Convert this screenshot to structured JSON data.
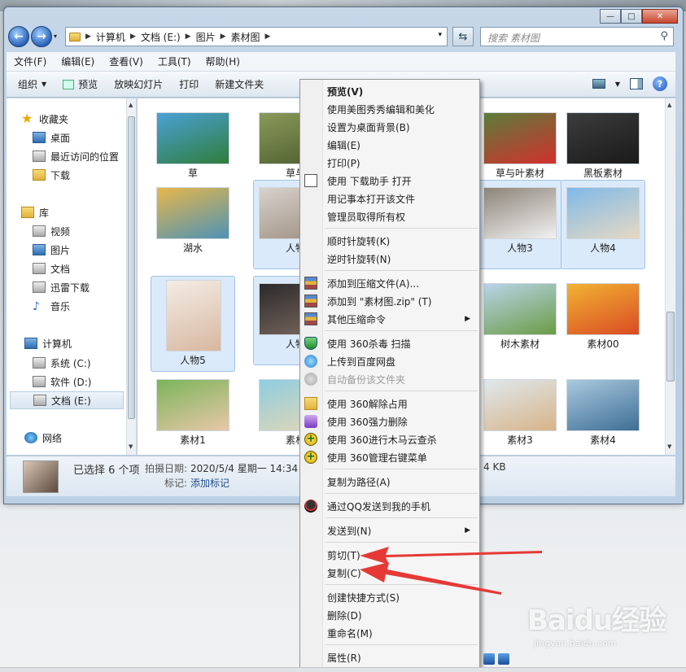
{
  "window": {
    "minimize": "—",
    "maximize": "□",
    "close": "✕"
  },
  "nav": {
    "back": "←",
    "forward": "→",
    "history_dropdown": "▾",
    "refresh": "⇆",
    "address_dropdown": "▾",
    "breadcrumbs": [
      "计算机",
      "文档 (E:)",
      "图片",
      "素材图"
    ],
    "search_placeholder": "搜索 素材图",
    "search_icon": "⚲"
  },
  "menubar": [
    "文件(F)",
    "编辑(E)",
    "查看(V)",
    "工具(T)",
    "帮助(H)"
  ],
  "toolbar": {
    "organize": "组织",
    "preview": "预览",
    "slideshow": "放映幻灯片",
    "print": "打印",
    "new_folder": "新建文件夹",
    "help": "?"
  },
  "sidebar": {
    "favorites": "收藏夹",
    "desktop": "桌面",
    "recent": "最近访问的位置",
    "downloads": "下载",
    "libraries": "库",
    "videos": "视频",
    "pictures": "图片",
    "documents": "文档",
    "xunlei": "迅雷下载",
    "music": "音乐",
    "computer": "计算机",
    "drive_c": "系统 (C:)",
    "drive_d": "软件 (D:)",
    "drive_e": "文档 (E:)",
    "network": "网络"
  },
  "files": [
    {
      "name": "草",
      "color1": "#4aa1d6",
      "color2": "#2f7d3c"
    },
    {
      "name": "草与",
      "color1": "#8a9a5a",
      "color2": "#4c5c2e"
    },
    {
      "name": "草与叶素材",
      "color1": "#5b7d3a",
      "color2": "#d2302c"
    },
    {
      "name": "黑板素材",
      "color1": "#3c3c3c",
      "color2": "#1a1a1a"
    },
    {
      "name": "湖水",
      "color1": "#e7b74a",
      "color2": "#4e92b6"
    },
    {
      "name": "人物",
      "color1": "#d7d2cc",
      "color2": "#9d8e80"
    },
    {
      "name": "人物3",
      "color1": "#8c8478",
      "color2": "#f2f2f2"
    },
    {
      "name": "人物4",
      "color1": "#7fb9e8",
      "color2": "#e6d9c4"
    },
    {
      "name": "人物5",
      "color1": "#f3ece5",
      "color2": "#d8b8a0"
    },
    {
      "name": "人物",
      "color1": "#2a2a2a",
      "color2": "#7d6a60"
    },
    {
      "name": "树木素材",
      "color1": "#b8d4e8",
      "color2": "#6b9c46"
    },
    {
      "name": "素材00",
      "color1": "#f2b233",
      "color2": "#d94c23"
    },
    {
      "name": "素材1",
      "color1": "#7bb45a",
      "color2": "#e8c7a8"
    },
    {
      "name": "素材",
      "color1": "#8ecde0",
      "color2": "#e6d7b4"
    },
    {
      "name": "素材3",
      "color1": "#dfe8ee",
      "color2": "#d7b488"
    },
    {
      "name": "素材4",
      "color1": "#aac9de",
      "color2": "#3e6e96"
    }
  ],
  "status": {
    "selected": "已选择 6 个项",
    "date_label": "拍摄日期:",
    "date_value": "2020/5/4 星期一 14:34",
    "tag_label": "标记:",
    "tag_value": "添加标记",
    "size_fragment": "4 KB"
  },
  "context_menu": {
    "preview": "预览(V)",
    "meitu": "使用美图秀秀编辑和美化",
    "set_wallpaper": "设置为桌面背景(B)",
    "edit": "编辑(E)",
    "print": "打印(P)",
    "open_download": "使用 下载助手 打开",
    "open_notepad": "用记事本打开该文件",
    "take_ownership": "管理员取得所有权",
    "rotate_cw": "顺时针旋转(K)",
    "rotate_ccw": "逆时针旋转(N)",
    "add_archive": "添加到压缩文件(A)...",
    "add_zip": "添加到 \"素材图.zip\" (T)",
    "other_zip": "其他压缩命令",
    "scan_360": "使用 360杀毒 扫描",
    "upload_baidu": "上传到百度网盘",
    "auto_backup": "自动备份该文件夹",
    "unlock_360": "使用 360解除占用",
    "force_delete_360": "使用 360强力删除",
    "trojan_360": "使用 360进行木马云查杀",
    "manage_menu_360": "使用 360管理右键菜单",
    "copy_path": "复制为路径(A)",
    "send_qq": "通过QQ发送到我的手机",
    "send_to": "发送到(N)",
    "cut": "剪切(T)",
    "copy": "复制(C)",
    "create_shortcut": "创建快捷方式(S)",
    "delete": "删除(D)",
    "rename": "重命名(M)",
    "properties": "属性(R)",
    "submenu_arrow": "▶"
  },
  "watermark": {
    "logo": "Baidu经验",
    "url": "jingyan.baidu.com"
  },
  "colors": {
    "accent_arrow": "#e53935",
    "selection": "#dbeafa"
  }
}
